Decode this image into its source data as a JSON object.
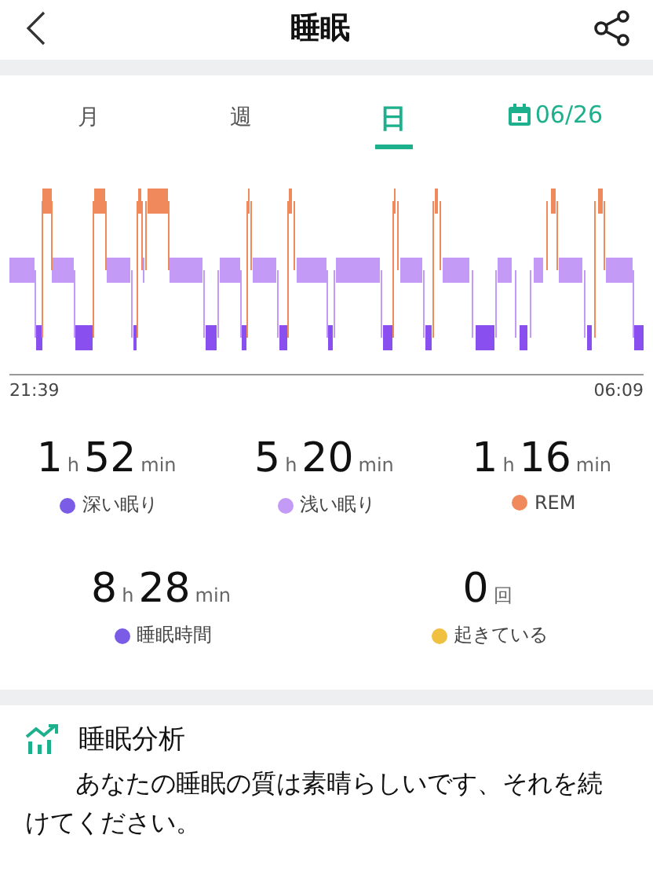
{
  "header": {
    "title": "睡眠"
  },
  "tabs": [
    {
      "label": "月",
      "selected": false
    },
    {
      "label": "週",
      "selected": false
    },
    {
      "label": "日",
      "selected": true
    }
  ],
  "date": "06/26",
  "chart": {
    "start_time": "21:39",
    "end_time": "06:09"
  },
  "stats": [
    {
      "kind": "duration",
      "hours": "1",
      "hour_unit": "h",
      "minutes": "52",
      "minute_unit": "min",
      "label": "深い眠り",
      "color": "#7b5ce6"
    },
    {
      "kind": "duration",
      "hours": "5",
      "hour_unit": "h",
      "minutes": "20",
      "minute_unit": "min",
      "label": "浅い眠り",
      "color": "#c39af5"
    },
    {
      "kind": "duration",
      "hours": "1",
      "hour_unit": "h",
      "minutes": "16",
      "minute_unit": "min",
      "label": "REM",
      "color": "#f08a5d"
    },
    {
      "kind": "duration",
      "hours": "8",
      "hour_unit": "h",
      "minutes": "28",
      "minute_unit": "min",
      "label": "睡眠時間",
      "color": "#7b5ce6"
    },
    {
      "kind": "count",
      "count": "0",
      "unit": "回",
      "label": "起きている",
      "color": "#f0c040"
    }
  ],
  "analysis": {
    "title": "睡眠分析",
    "text": "あなたの睡眠の質は素晴らしいです、それを続けてください。"
  }
}
